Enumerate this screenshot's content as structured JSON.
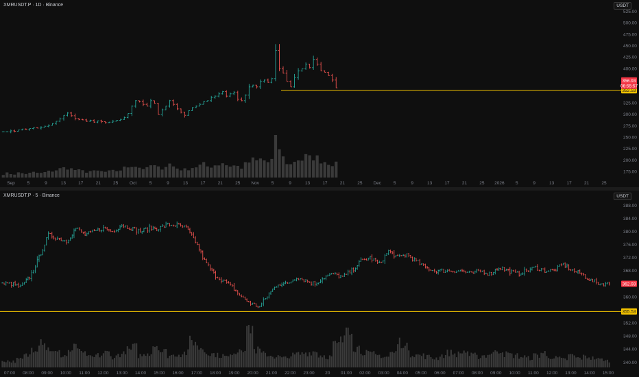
{
  "colors": {
    "background": "#0f0f0f",
    "up": "#26a69a",
    "down": "#ef5350",
    "volume": "#4a4a4a",
    "level_line": "#f2c200",
    "price_badge": "#f23645",
    "level_badge": "#f2c200"
  },
  "chart_data": [
    {
      "type": "ohlc",
      "title": "XMRUSDT.P · 1D · Binance",
      "unit_label": "USDT",
      "y_ticks": [
        "525.00",
        "500.00",
        "475.00",
        "450.00",
        "425.00",
        "400.00",
        "375.00",
        "350.00",
        "325.00",
        "300.00",
        "275.00",
        "250.00",
        "225.00",
        "200.00",
        "175.00"
      ],
      "ylim": [
        162,
        532
      ],
      "x_ticks": [
        "Sep",
        "5",
        "9",
        "13",
        "17",
        "21",
        "25",
        "Oct",
        "5",
        "9",
        "13",
        "17",
        "21",
        "25",
        "Nov",
        "5",
        "9",
        "13",
        "17",
        "21",
        "25",
        "Dec",
        "5",
        "9",
        "13",
        "17",
        "21",
        "25",
        "2026",
        "5",
        "9",
        "13",
        "17",
        "21",
        "25"
      ],
      "price_badge": {
        "line1": "356.93",
        "line2": "06:55:57"
      },
      "level_badge": "352.53",
      "level": 352.53,
      "close_series": [
        262,
        262,
        264,
        263,
        266,
        268,
        267,
        269,
        271,
        270,
        272,
        274,
        276,
        280,
        285,
        290,
        298,
        303,
        297,
        291,
        289,
        288,
        285,
        287,
        283,
        286,
        284,
        282,
        283,
        285,
        287,
        289,
        293,
        302,
        318,
        330,
        328,
        322,
        318,
        330,
        324,
        300,
        310,
        318,
        330,
        322,
        312,
        305,
        298,
        308,
        315,
        318,
        322,
        328,
        330,
        337,
        340,
        345,
        350,
        340,
        345,
        348,
        333,
        330,
        342,
        360,
        364,
        360,
        372,
        375,
        370,
        378,
        440,
        400,
        390,
        372,
        360,
        380,
        395,
        400,
        410,
        402,
        420,
        410,
        395,
        392,
        385,
        375,
        358
      ],
      "volume_series": [
        8,
        10,
        9,
        8,
        11,
        10,
        9,
        10,
        12,
        11,
        10,
        12,
        14,
        16,
        18,
        20,
        22,
        24,
        20,
        18,
        16,
        15,
        14,
        15,
        14,
        15,
        14,
        13,
        14,
        15,
        16,
        18,
        22,
        26,
        30,
        28,
        24,
        22,
        20,
        28,
        26,
        22,
        24,
        28,
        32,
        26,
        22,
        20,
        18,
        22,
        24,
        26,
        28,
        30,
        26,
        28,
        30,
        32,
        36,
        30,
        28,
        28,
        26,
        24,
        30,
        36,
        40,
        38,
        42,
        40,
        36,
        40,
        100,
        70,
        45,
        36,
        30,
        40,
        44,
        42,
        48,
        44,
        50,
        45,
        42,
        38,
        36,
        34,
        30
      ]
    },
    {
      "type": "ohlc",
      "title": "XMRUSDT.P · 5 · Binance",
      "unit_label": "USDT",
      "y_ticks": [
        "388.00",
        "384.00",
        "380.00",
        "376.00",
        "372.00",
        "368.00",
        "364.00",
        "360.00",
        "356.00",
        "352.00",
        "348.00",
        "344.00",
        "340.00"
      ],
      "ylim": [
        338,
        390
      ],
      "x_ticks": [
        "07:00",
        "08:00",
        "09:00",
        "10:00",
        "11:00",
        "12:00",
        "13:00",
        "14:00",
        "15:00",
        "16:00",
        "17:00",
        "18:00",
        "19:00",
        "20:00",
        "21:00",
        "22:00",
        "23:00",
        "20",
        "01:00",
        "02:00",
        "03:00",
        "04:00",
        "05:00",
        "06:00",
        "07:00",
        "08:00",
        "09:00",
        "10:00",
        "11:00",
        "12:00",
        "13:00",
        "14:00",
        "15:00"
      ],
      "price_badge": "362.93",
      "level_badge": "355.53",
      "level": 355.53,
      "waypoints": [
        364,
        364,
        363,
        366,
        372,
        379,
        378,
        377,
        381,
        379,
        380,
        381,
        380,
        382,
        381,
        380,
        381,
        381,
        382,
        382,
        381,
        377,
        371,
        367,
        365,
        363,
        360,
        358,
        357,
        361,
        364,
        364,
        366,
        365,
        364,
        366,
        367,
        366,
        368,
        371,
        372,
        370,
        374,
        372,
        373,
        371,
        369,
        368,
        368,
        368,
        368,
        367,
        368,
        367,
        369,
        368,
        367,
        368,
        369,
        368,
        368,
        370,
        368,
        367,
        365,
        364,
        364
      ],
      "volume_series": [
        10,
        9,
        12,
        18,
        30,
        42,
        28,
        22,
        18,
        25,
        30,
        20,
        15,
        18,
        22,
        16,
        20,
        26,
        30,
        18,
        22,
        34,
        24,
        18,
        20,
        22,
        40,
        30,
        24,
        20,
        18,
        16,
        24,
        30,
        62,
        26,
        20,
        18,
        16,
        14,
        18,
        20,
        22,
        24,
        18,
        16,
        34,
        40,
        64,
        30,
        24,
        20,
        18,
        16,
        22,
        38,
        30,
        20,
        18,
        16,
        14,
        18,
        22,
        20,
        24,
        18,
        16,
        18,
        22,
        26,
        20,
        18,
        16,
        14,
        18,
        22,
        16,
        14,
        12,
        18,
        14,
        16,
        14,
        12,
        10
      ]
    }
  ]
}
